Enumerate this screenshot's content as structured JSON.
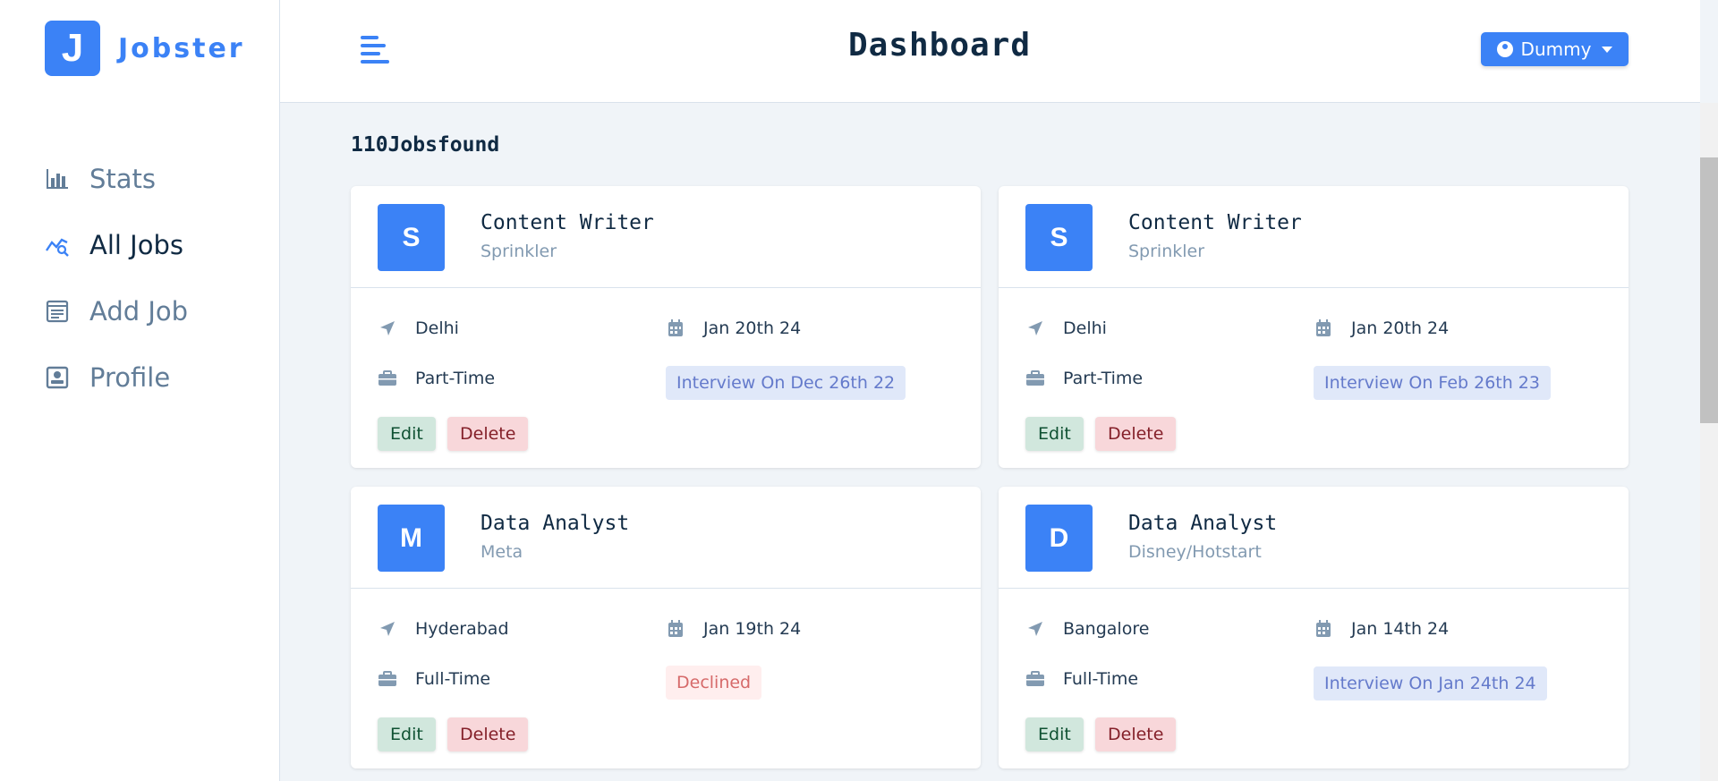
{
  "app": {
    "logo_letter": "J",
    "name": "Jobster"
  },
  "sidebar": {
    "items": [
      {
        "label": "Stats",
        "icon": "bar-chart-icon"
      },
      {
        "label": "All Jobs",
        "icon": "chart-search-icon",
        "active": true
      },
      {
        "label": "Add Job",
        "icon": "form-icon"
      },
      {
        "label": "Profile",
        "icon": "id-card-icon"
      }
    ]
  },
  "header": {
    "title": "Dashboard",
    "user": "Dummy"
  },
  "jobs_count": "110Jobsfound",
  "jobs": [
    {
      "initial": "S",
      "position": "Content Writer",
      "company": "Sprinkler",
      "location": "Delhi",
      "date": "Jan 20th 24",
      "type": "Part-Time",
      "status": "Interview On Dec 26th 22",
      "status_kind": "interview",
      "edit": "Edit",
      "delete": "Delete"
    },
    {
      "initial": "S",
      "position": "Content Writer",
      "company": "Sprinkler",
      "location": "Delhi",
      "date": "Jan 20th 24",
      "type": "Part-Time",
      "status": "Interview On Feb 26th 23",
      "status_kind": "interview",
      "edit": "Edit",
      "delete": "Delete"
    },
    {
      "initial": "M",
      "position": "Data Analyst",
      "company": "Meta",
      "location": "Hyderabad",
      "date": "Jan 19th 24",
      "type": "Full-Time",
      "status": "Declined",
      "status_kind": "declined",
      "edit": "Edit",
      "delete": "Delete"
    },
    {
      "initial": "D",
      "position": "Data Analyst",
      "company": "Disney/Hotstart",
      "location": "Bangalore",
      "date": "Jan 14th 24",
      "type": "Full-Time",
      "status": "Interview On Jan 24th 24",
      "status_kind": "interview",
      "edit": "Edit",
      "delete": "Delete"
    }
  ],
  "colors": {
    "primary": "#3b82f6",
    "text": "#102a43",
    "muted": "#627d98"
  }
}
